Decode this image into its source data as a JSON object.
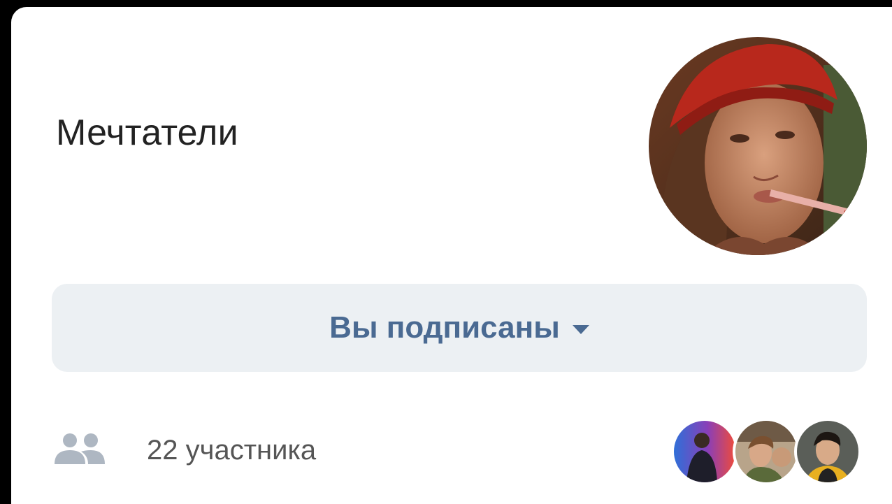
{
  "group": {
    "title": "Мечтатели"
  },
  "subscribe": {
    "label": "Вы подписаны"
  },
  "members": {
    "count_text": "22 участника"
  },
  "icons": {
    "members": "people-icon",
    "dropdown": "caret-down-icon"
  },
  "colors": {
    "button_bg": "#ecf0f3",
    "button_text": "#4a6a92",
    "title_text": "#222222",
    "secondary_text": "#555555",
    "icon_gray": "#aeb7c2"
  }
}
